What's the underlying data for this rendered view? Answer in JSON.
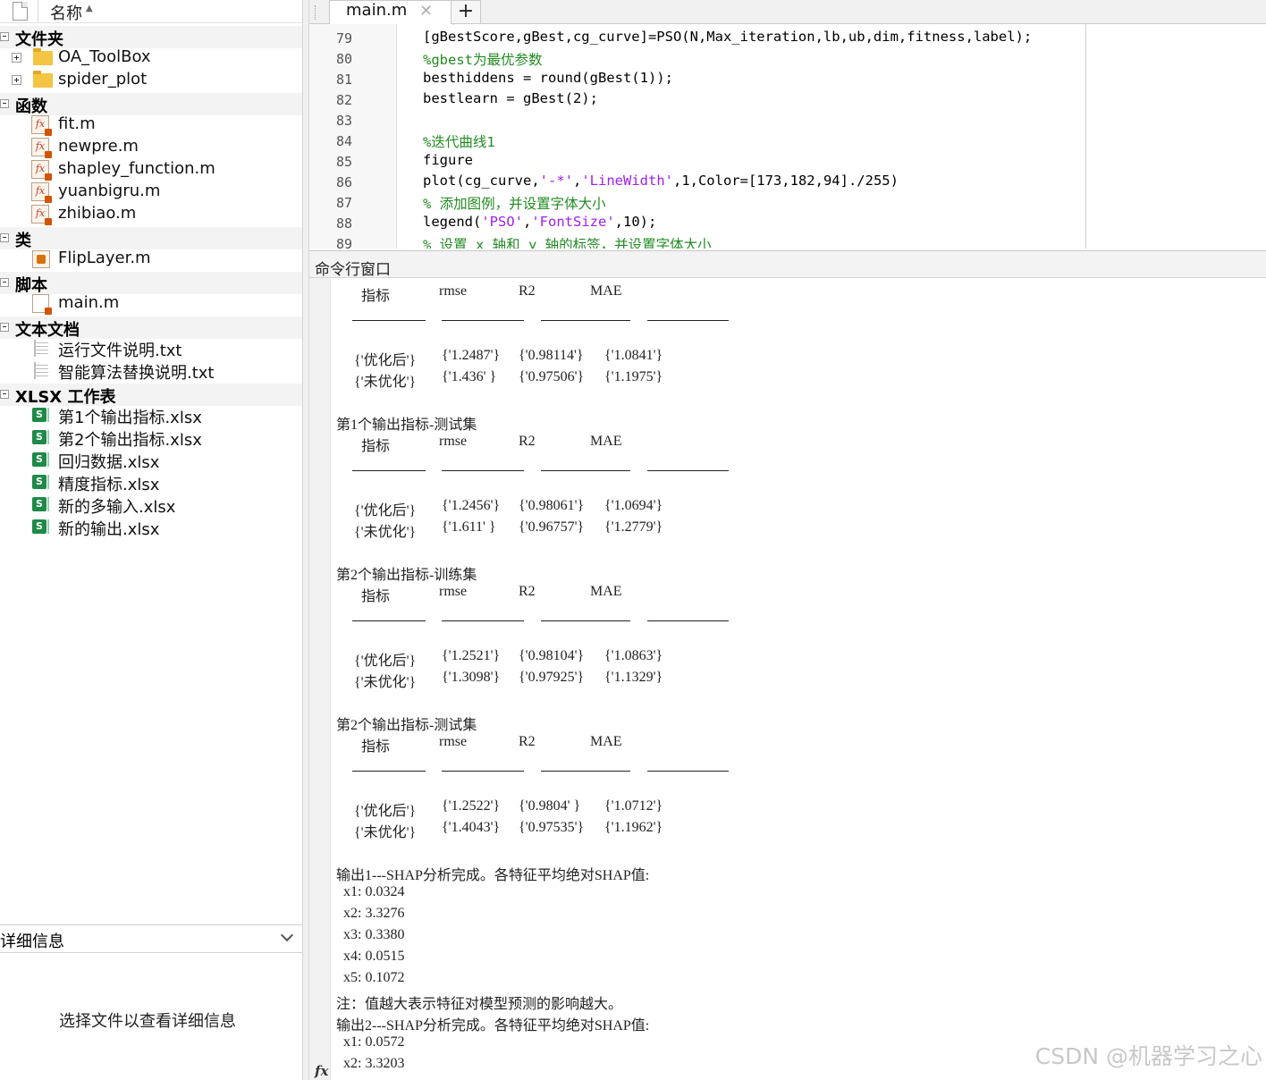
{
  "browser": {
    "header_label": "名称",
    "sort_indicator": "▲",
    "groups": [
      {
        "label": "文件夹",
        "items": [
          "OA_ToolBox",
          "spider_plot"
        ]
      },
      {
        "label": "函数",
        "items": [
          "fit.m",
          "newpre.m",
          "shapley_function.m",
          "yuanbigru.m",
          "zhibiao.m"
        ]
      },
      {
        "label": "类",
        "items": [
          "FlipLayer.m"
        ]
      },
      {
        "label": "脚本",
        "items": [
          "main.m"
        ]
      },
      {
        "label": "文本文档",
        "items": [
          "运行文件说明.txt",
          "智能算法替换说明.txt"
        ]
      },
      {
        "label": "XLSX 工作表",
        "items": [
          "第1个输出指标.xlsx",
          "第2个输出指标.xlsx",
          "回归数据.xlsx",
          "精度指标.xlsx",
          "新的多输入.xlsx",
          "新的输出.xlsx"
        ]
      }
    ],
    "xlsx_icon_letter": "S",
    "details_title": "详细信息",
    "details_empty": "选择文件以查看详细信息"
  },
  "editor": {
    "tab_label": "main.m",
    "tab_close": "✕",
    "tab_add": "+",
    "line_numbers": [
      "79",
      "80",
      "81",
      "82",
      "83",
      "84",
      "85",
      "86",
      "87",
      "88",
      "89"
    ],
    "code": {
      "l79": "[gBestScore,gBest,cg_curve]=PSO(N,Max_iteration,lb,ub,dim,fitness,label);",
      "l80": "%gbest为最优参数",
      "l81": "besthiddens = round(gBest(1));",
      "l82": "bestlearn = gBest(2);",
      "l83": "",
      "l84": "%迭代曲线1",
      "l85": "figure",
      "l86_a": "plot(cg_curve,",
      "l86_b": "'-*'",
      "l86_c": ",",
      "l86_d": "'LineWidth'",
      "l86_e": ",1,Color=[173,182,94]./255)",
      "l87": "% 添加图例，并设置字体大小",
      "l88_a": "legend(",
      "l88_b": "'PSO'",
      "l88_c": ",",
      "l88_d": "'FontSize'",
      "l88_e": ",10);",
      "l89": "% 设置 x 轴和 y 轴的标签，并设置字体大小"
    }
  },
  "command_window": {
    "title": "命令行窗口",
    "table_headers": [
      "指标",
      "rmse",
      "R2",
      "MAE"
    ],
    "tables": [
      {
        "title": "",
        "rows": [
          [
            "{'优化后'}",
            "{'1.2487'}",
            "{'0.98114'}",
            "{'1.0841'}"
          ],
          [
            "{'未优化'}",
            "{'1.436' }",
            "{'0.97506'}",
            "{'1.1975'}"
          ]
        ]
      },
      {
        "title": "第1个输出指标-测试集",
        "rows": [
          [
            "{'优化后'}",
            "{'1.2456'}",
            "{'0.98061'}",
            "{'1.0694'}"
          ],
          [
            "{'未优化'}",
            "{'1.611' }",
            "{'0.96757'}",
            "{'1.2779'}"
          ]
        ]
      },
      {
        "title": "第2个输出指标-训练集",
        "rows": [
          [
            "{'优化后'}",
            "{'1.2521'}",
            "{'0.98104'}",
            "{'1.0863'}"
          ],
          [
            "{'未优化'}",
            "{'1.3098'}",
            "{'0.97925'}",
            "{'1.1329'}"
          ]
        ]
      },
      {
        "title": "第2个输出指标-测试集",
        "rows": [
          [
            "{'优化后'}",
            "{'1.2522'}",
            "{'0.9804' }",
            "{'1.0712'}"
          ],
          [
            "{'未优化'}",
            "{'1.4043'}",
            "{'0.97535'}",
            "{'1.1962'}"
          ]
        ]
      }
    ],
    "shap1_title": "输出1---SHAP分析完成。各特征平均绝对SHAP值:",
    "shap1_values": [
      "x1: 0.0324",
      "x2: 3.3276",
      "x3: 0.3380",
      "x4: 0.0515",
      "x5: 0.1072"
    ],
    "note": "注：值越大表示特征对模型预测的影响越大。",
    "shap2_title": "输出2---SHAP分析完成。各特征平均绝对SHAP值:",
    "shap2_values": [
      "x1: 0.0572",
      "x2: 3.3203"
    ],
    "prompt_icon": "fx"
  },
  "watermark": "CSDN @机器学习之心"
}
